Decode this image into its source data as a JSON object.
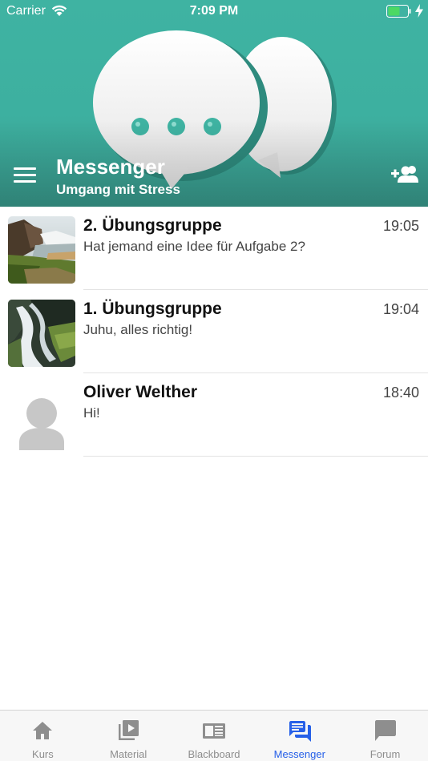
{
  "status_bar": {
    "carrier": "Carrier",
    "time": "7:09 PM"
  },
  "header": {
    "title": "Messenger",
    "subtitle": "Umgang mit Stress",
    "color": "#3fb3a2"
  },
  "chats": [
    {
      "name": "2. Übungsgruppe",
      "message": "Hat jemand eine Idee für Aufgabe 2?",
      "time": "19:05",
      "avatar": "waterfall-landscape"
    },
    {
      "name": "1. Übungsgruppe",
      "message": "Juhu, alles richtig!",
      "time": "19:04",
      "avatar": "waterfall-closeup"
    },
    {
      "name": "Oliver Welther",
      "message": "Hi!",
      "time": "18:40",
      "avatar": "default-person"
    }
  ],
  "tabs": [
    {
      "label": "Kurs",
      "icon": "home-icon"
    },
    {
      "label": "Material",
      "icon": "video-library-icon"
    },
    {
      "label": "Blackboard",
      "icon": "newspaper-icon"
    },
    {
      "label": "Messenger",
      "icon": "chat-icon",
      "active": true
    },
    {
      "label": "Forum",
      "icon": "comment-icon"
    }
  ],
  "colors": {
    "active_tab": "#2660e8",
    "inactive_tab": "#8e8e8e"
  }
}
